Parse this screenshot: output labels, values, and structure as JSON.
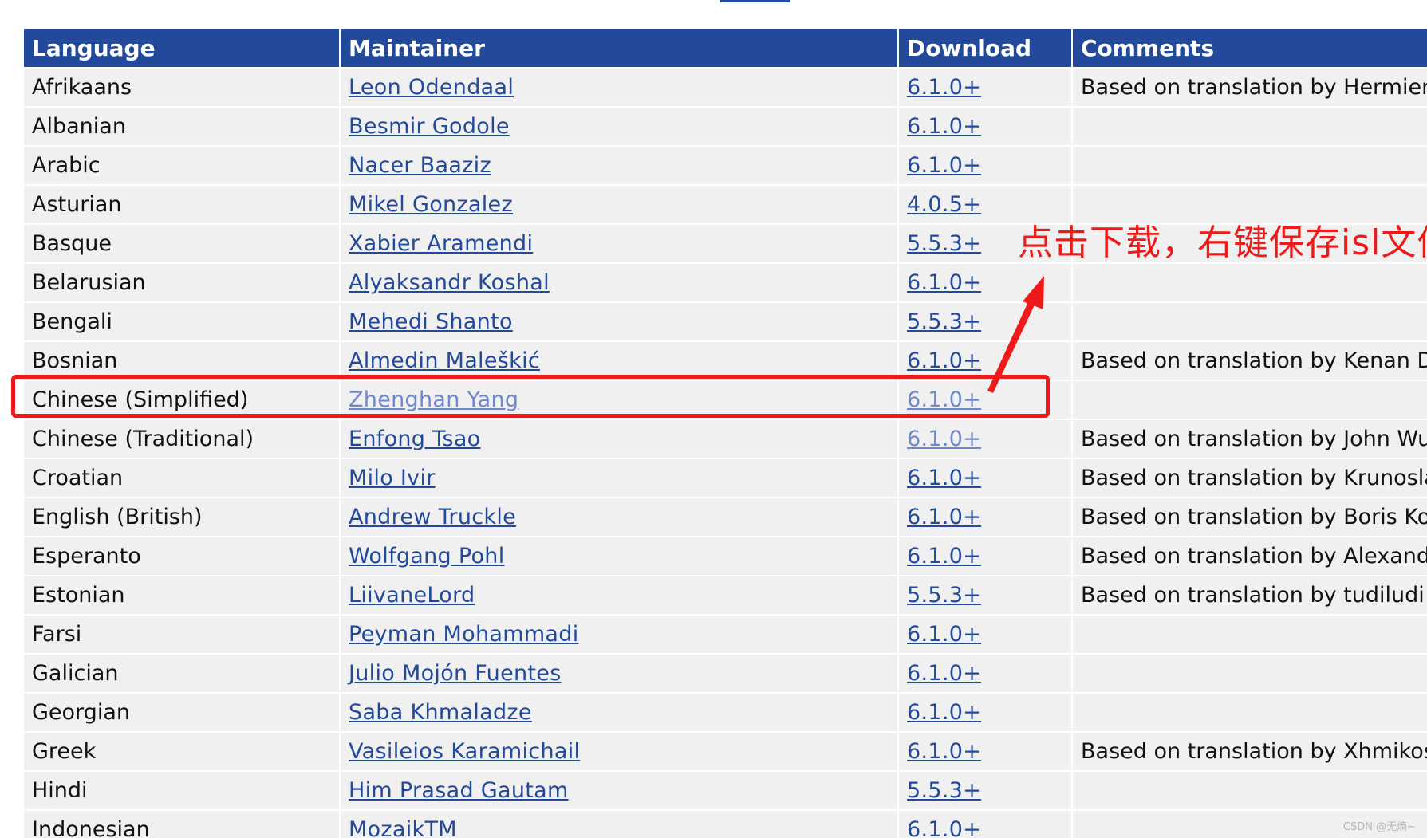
{
  "table": {
    "headers": [
      "Language",
      "Maintainer",
      "Download",
      "Comments"
    ],
    "rows": [
      {
        "language": "Afrikaans",
        "maintainer": "Leon Odendaal",
        "download": "6.1.0+",
        "comments": "Based on translation by Hermien"
      },
      {
        "language": "Albanian",
        "maintainer": "Besmir Godole",
        "download": "6.1.0+",
        "comments": ""
      },
      {
        "language": "Arabic",
        "maintainer": "Nacer Baaziz",
        "download": "6.1.0+",
        "comments": ""
      },
      {
        "language": "Asturian",
        "maintainer": "Mikel Gonzalez",
        "download": "4.0.5+",
        "comments": ""
      },
      {
        "language": "Basque",
        "maintainer": "Xabier Aramendi",
        "download": "5.5.3+",
        "comments": ""
      },
      {
        "language": "Belarusian",
        "maintainer": "Alyaksandr Koshal",
        "download": "6.1.0+",
        "comments": ""
      },
      {
        "language": "Bengali",
        "maintainer": "Mehedi Shanto",
        "download": "5.5.3+",
        "comments": ""
      },
      {
        "language": "Bosnian",
        "maintainer": "Almedin Maleškić",
        "download": "6.1.0+",
        "comments": "Based on translation by Kenan Dc"
      },
      {
        "language": "Chinese (Simplified)",
        "maintainer": "Zhenghan Yang",
        "download": "6.1.0+",
        "comments": ""
      },
      {
        "language": "Chinese (Traditional)",
        "maintainer": "Enfong Tsao",
        "download": "6.1.0+",
        "comments": "Based on translation by John Wu"
      },
      {
        "language": "Croatian",
        "maintainer": "Milo Ivir",
        "download": "6.1.0+",
        "comments": "Based on translation by Krunosla"
      },
      {
        "language": "English (British)",
        "maintainer": "Andrew Truckle",
        "download": "6.1.0+",
        "comments": "Based on translation by Boris Kot"
      },
      {
        "language": "Esperanto",
        "maintainer": "Wolfgang Pohl",
        "download": "6.1.0+",
        "comments": "Based on translation by Alexande"
      },
      {
        "language": "Estonian",
        "maintainer": "LiivaneLord",
        "download": "5.5.3+",
        "comments": "Based on translation by tudiludi"
      },
      {
        "language": "Farsi",
        "maintainer": "Peyman Mohammadi",
        "download": "6.1.0+",
        "comments": ""
      },
      {
        "language": "Galician",
        "maintainer": "Julio Mojón Fuentes",
        "download": "6.1.0+",
        "comments": ""
      },
      {
        "language": "Georgian",
        "maintainer": "Saba Khmaladze",
        "download": "6.1.0+",
        "comments": ""
      },
      {
        "language": "Greek",
        "maintainer": "Vasileios Karamichail",
        "download": "6.1.0+",
        "comments": "Based on translation by Xhmikosi"
      },
      {
        "language": "Hindi",
        "maintainer": "Him Prasad Gautam",
        "download": "5.5.3+",
        "comments": ""
      },
      {
        "language": "Indonesian",
        "maintainer": "MozaikTM",
        "download": "6.1.0+",
        "comments": ""
      }
    ]
  },
  "annotation": {
    "text": "点击下载，右键保存isl文件",
    "color": "#ee1a1a"
  },
  "watermark": "CSDN @无熵~",
  "colors": {
    "header_bg": "#23499a",
    "link": "#23499a",
    "visited_link": "#6f88cc",
    "row_bg": "#f0f0f0"
  }
}
